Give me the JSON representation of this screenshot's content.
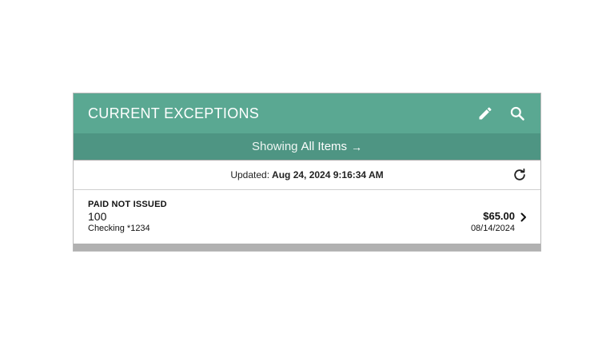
{
  "header": {
    "title": "CURRENT EXCEPTIONS",
    "icons": [
      "pencil-icon",
      "search-icon"
    ],
    "accent_color": "#5aa892",
    "filter_bar_color": "#4e9583"
  },
  "filter": {
    "prefix": "Showing",
    "selection": "All Items",
    "arrow": "→"
  },
  "updated": {
    "label": "Updated:",
    "value": "Aug 24, 2024 9:16:34 AM",
    "icon": "refresh-icon"
  },
  "exceptions": [
    {
      "type": "PAID NOT ISSUED",
      "number": "100",
      "account": "Checking *1234",
      "amount": "$65.00",
      "date": "08/14/2024"
    }
  ]
}
